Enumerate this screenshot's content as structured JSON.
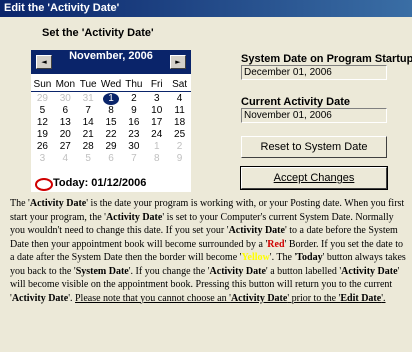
{
  "window": {
    "title": "Edit the 'Activity Date'"
  },
  "calendar": {
    "heading": "Set the 'Activity Date'",
    "month_label": "November, 2006",
    "prev_icon": "◄",
    "next_icon": "►",
    "weekdays": [
      "Sun",
      "Mon",
      "Tue",
      "Wed",
      "Thu",
      "Fri",
      "Sat"
    ],
    "weeks": [
      [
        {
          "d": "29",
          "o": true
        },
        {
          "d": "30",
          "o": true
        },
        {
          "d": "31",
          "o": true
        },
        {
          "d": "1",
          "sel": true
        },
        {
          "d": "2"
        },
        {
          "d": "3"
        },
        {
          "d": "4"
        }
      ],
      [
        {
          "d": "5"
        },
        {
          "d": "6"
        },
        {
          "d": "7"
        },
        {
          "d": "8"
        },
        {
          "d": "9"
        },
        {
          "d": "10"
        },
        {
          "d": "11"
        }
      ],
      [
        {
          "d": "12"
        },
        {
          "d": "13"
        },
        {
          "d": "14"
        },
        {
          "d": "15"
        },
        {
          "d": "16"
        },
        {
          "d": "17"
        },
        {
          "d": "18"
        }
      ],
      [
        {
          "d": "19"
        },
        {
          "d": "20"
        },
        {
          "d": "21"
        },
        {
          "d": "22"
        },
        {
          "d": "23"
        },
        {
          "d": "24"
        },
        {
          "d": "25"
        }
      ],
      [
        {
          "d": "26"
        },
        {
          "d": "27"
        },
        {
          "d": "28"
        },
        {
          "d": "29"
        },
        {
          "d": "30"
        },
        {
          "d": "1",
          "o": true
        },
        {
          "d": "2",
          "o": true
        }
      ],
      [
        {
          "d": "3",
          "o": true
        },
        {
          "d": "4",
          "o": true
        },
        {
          "d": "5",
          "o": true
        },
        {
          "d": "6",
          "o": true
        },
        {
          "d": "7",
          "o": true
        },
        {
          "d": "8",
          "o": true
        },
        {
          "d": "9",
          "o": true
        }
      ]
    ],
    "today_label": "Today: 01/12/2006"
  },
  "system_date": {
    "label": "System Date on Program Startup",
    "value": "December 01, 2006"
  },
  "current_date": {
    "label": "Current Activity Date",
    "value": "November 01, 2006"
  },
  "buttons": {
    "reset": "Reset to System Date",
    "accept": "Accept Changes"
  },
  "description": [
    {
      "t": "The '"
    },
    {
      "t": "Activity Date",
      "s": "b"
    },
    {
      "t": "' is the date your program is working with, or your Posting date. When you first start your program, the '"
    },
    {
      "t": "Activity Date",
      "s": "b"
    },
    {
      "t": "' is set to your Computer's current System Date. Normally you wouldn't need to change this date. If you set your '"
    },
    {
      "t": "Activity Date",
      "s": "b"
    },
    {
      "t": "' to a date before the System Date then your appointment book will become surrounded by a '"
    },
    {
      "t": "Red",
      "s": "red"
    },
    {
      "t": "' Border. If you set the date to a date after the System Date then the border will become '"
    },
    {
      "t": "Yellow",
      "s": "yel"
    },
    {
      "t": "'. The '"
    },
    {
      "t": "Today",
      "s": "b"
    },
    {
      "t": "' button always takes you back to the '"
    },
    {
      "t": "System Date",
      "s": "b"
    },
    {
      "t": "'. If you change the '"
    },
    {
      "t": "Activity Date",
      "s": "b"
    },
    {
      "t": "' a button labelled '"
    },
    {
      "t": "Activity Date",
      "s": "b"
    },
    {
      "t": "' will become visible on the appointment book. Pressing this button will return you to the current '"
    },
    {
      "t": "Activity Date",
      "s": "b"
    },
    {
      "t": "'. "
    },
    {
      "t": "Please note that you cannot choose an '",
      "s": "u"
    },
    {
      "t": "Activity Date",
      "s": "ub"
    },
    {
      "t": "' prior to the '",
      "s": "u"
    },
    {
      "t": "Edit Date",
      "s": "ub"
    },
    {
      "t": "'.",
      "s": "u"
    }
  ],
  "colors": {
    "title_bar": "#0a246a",
    "calendar_header": "#0a246a",
    "border_red": "#d00000",
    "border_yellow": "#ffff00"
  }
}
